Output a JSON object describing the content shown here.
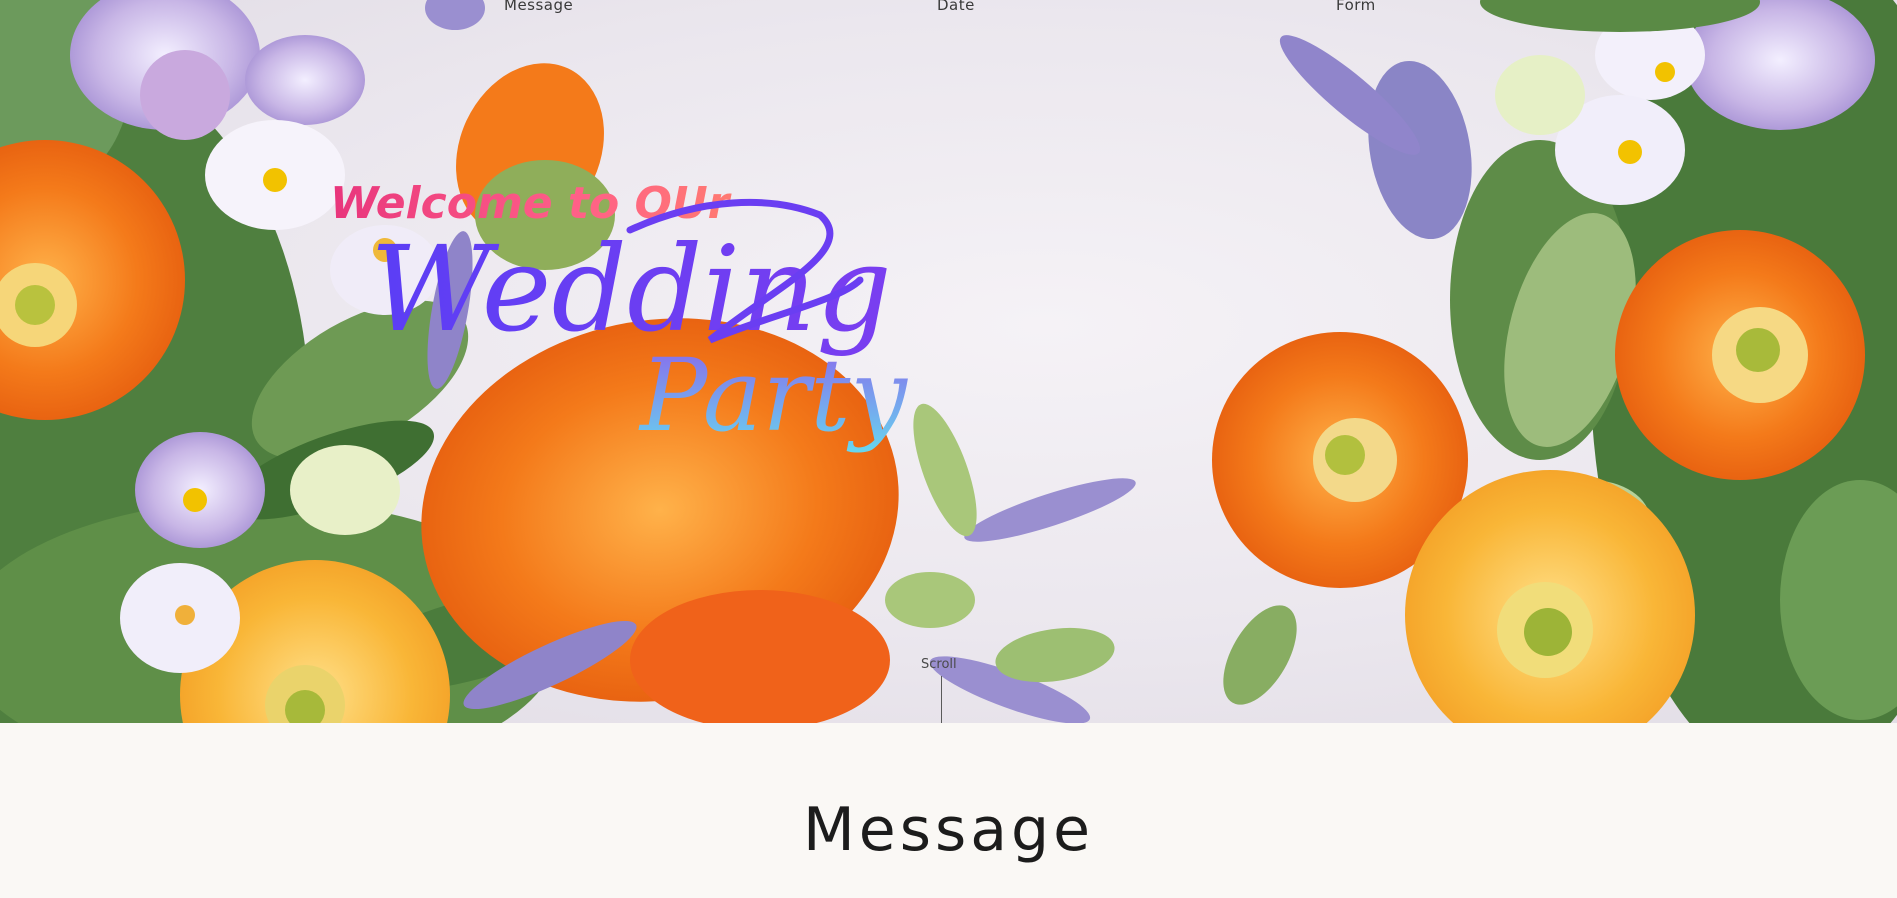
{
  "nav": {
    "items": [
      "Message",
      "Date",
      "Form"
    ]
  },
  "hero": {
    "title_line1": "Welcome to OUr",
    "title_line2": "Wedding",
    "title_line3": "Party",
    "scroll_label": "Scroll"
  },
  "section": {
    "heading": "Message"
  },
  "colors": {
    "poppy_orange": "#f47a1a",
    "poppy_yellow": "#f9b637",
    "pansy_lilac": "#b7a2d8",
    "leaf_green": "#6e9a54",
    "title_pink": "#f05a8a",
    "title_purple": "#6a3ef2",
    "title_cyan": "#6fd0f0"
  }
}
